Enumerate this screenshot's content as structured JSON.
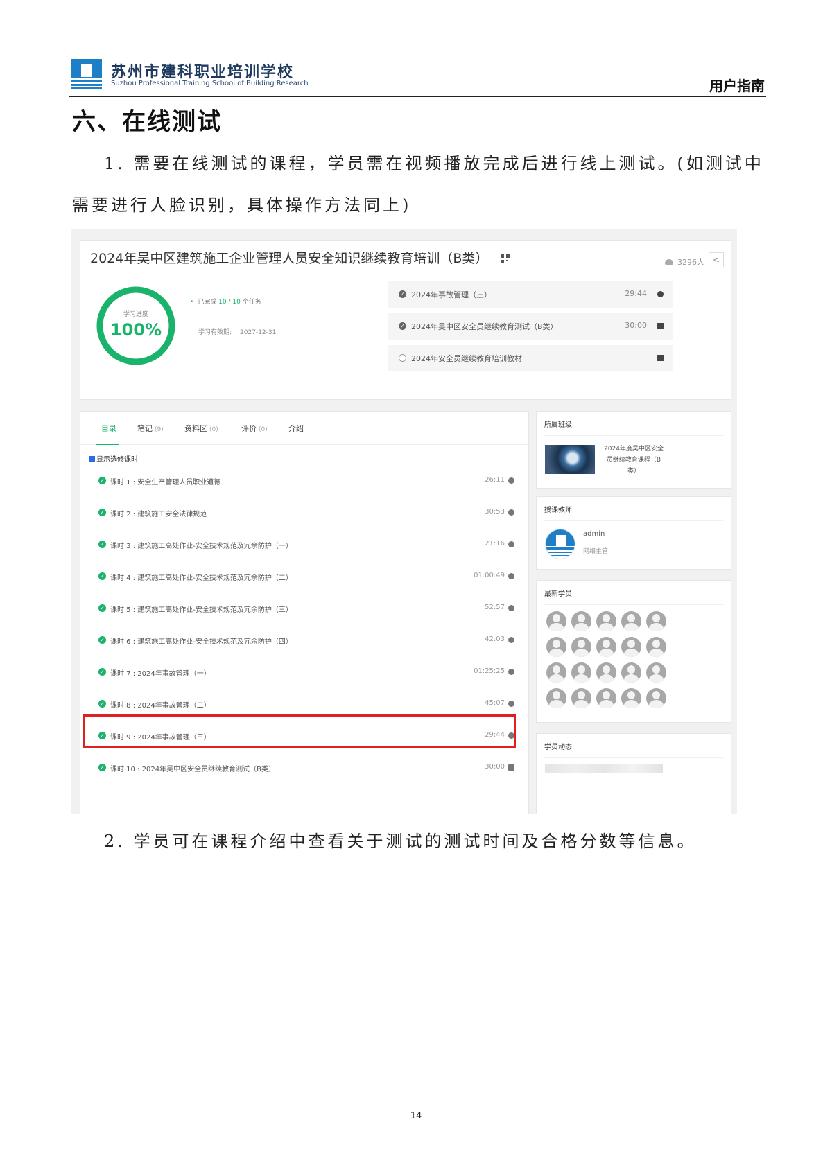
{
  "header": {
    "school_name_cn": "苏州市建科职业培训学校",
    "school_name_en": "Suzhou Professional Training School of Building Research",
    "guide_label": "用户指南"
  },
  "section": {
    "title": "六、在线测试"
  },
  "paragraphs": {
    "p1_line1": "1. 需要在线测试的课程，学员需在视频播放完成后进行线上测试。(如测试中",
    "p1_line2": "需要进行人脸识别，具体操作方法同上)",
    "p2": "2. 学员可在课程介绍中查看关于测试的测试时间及合格分数等信息。"
  },
  "screenshot": {
    "course_title": "2024年吴中区建筑施工企业管理人员安全知识继续教育培训（B类）",
    "student_count": "3296人",
    "progress_caption": "学习进度",
    "progress_value": "100%",
    "progress_fraction": 1.0,
    "completed_prefix": "已完成",
    "completed_count": "10 / 10",
    "completed_suffix": "个任务",
    "validity_label": "学习有效期:",
    "validity_date": "2027-12-31",
    "tasks": [
      {
        "title": "2024年事故管理（三）",
        "time": "29:44",
        "status": "done",
        "kind": "video"
      },
      {
        "title": "2024年吴中区安全员继续教育测试（B类）",
        "time": "30:00",
        "status": "done",
        "kind": "exam"
      },
      {
        "title": "2024年安全员继续教育培训教材",
        "time": "",
        "status": "todo",
        "kind": "document"
      }
    ],
    "tabs": [
      {
        "label": "目录",
        "count": ""
      },
      {
        "label": "笔记",
        "count": "(9)"
      },
      {
        "label": "资料区",
        "count": "(0)"
      },
      {
        "label": "评价",
        "count": "(0)"
      },
      {
        "label": "介绍",
        "count": ""
      }
    ],
    "show_elective_label": "显示选修课时",
    "lessons": [
      {
        "title": "课时 1 : 安全生产管理人员职业道德",
        "time": "26:11",
        "kind": "video"
      },
      {
        "title": "课时 2 : 建筑施工安全法律规范",
        "time": "30:53",
        "kind": "video"
      },
      {
        "title": "课时 3 : 建筑施工高处作业-安全技术规范及冗余防护（一）",
        "time": "21:16",
        "kind": "video"
      },
      {
        "title": "课时 4 : 建筑施工高处作业-安全技术规范及冗余防护（二）",
        "time": "01:00:49",
        "kind": "video"
      },
      {
        "title": "课时 5 : 建筑施工高处作业-安全技术规范及冗余防护（三）",
        "time": "52:57",
        "kind": "video"
      },
      {
        "title": "课时 6 : 建筑施工高处作业-安全技术规范及冗余防护（四）",
        "time": "42:03",
        "kind": "video"
      },
      {
        "title": "课时 7 : 2024年事故管理（一）",
        "time": "01:25:25",
        "kind": "video"
      },
      {
        "title": "课时 8 : 2024年事故管理（二）",
        "time": "45:07",
        "kind": "video"
      },
      {
        "title": "课时 9 : 2024年事故管理（三）",
        "time": "29:44",
        "kind": "video"
      },
      {
        "title": "课时 10 : 2024年吴中区安全员继续教育测试（B类）",
        "time": "30:00",
        "kind": "exam"
      }
    ],
    "sidebar": {
      "class_title": "所属班级",
      "class_name": "2024年度吴中区安全员继续教育课程（B类）",
      "teacher_title": "授课教师",
      "teacher_name": "admin",
      "teacher_role": "网络主管",
      "students_title": "最新学员",
      "activity_title": "学员动态"
    },
    "colors": {
      "accent": "#19b36b",
      "highlight": "#e02020",
      "logo_blue": "#1f7fc6"
    }
  },
  "page_number": "14"
}
